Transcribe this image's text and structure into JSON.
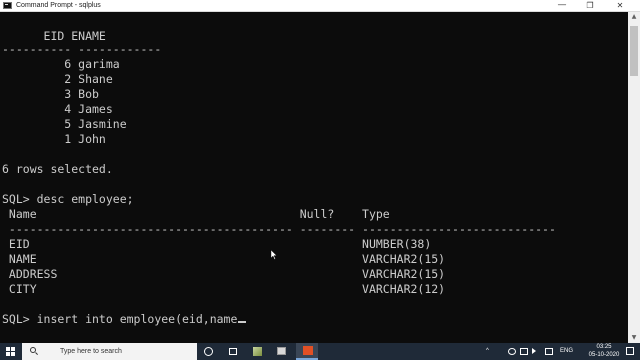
{
  "window": {
    "title": "Command Prompt - sqlplus",
    "minimize_glyph": "—",
    "maximize_glyph": "❐",
    "close_glyph": "✕"
  },
  "console": {
    "lines": [
      "      EID ENAME",
      "---------- ------------",
      "         6 garima",
      "         2 Shane",
      "         3 Bob",
      "         4 James",
      "         5 Jasmine",
      "         1 John",
      "",
      "6 rows selected.",
      "",
      "SQL> desc employee;",
      " Name                                      Null?    Type",
      " ----------------------------------------- -------- ----------------------------",
      " EID                                                NUMBER(38)",
      " NAME                                               VARCHAR2(15)",
      " ADDRESS                                            VARCHAR2(15)",
      " CITY                                               VARCHAR2(12)",
      "",
      "SQL> insert into employee(eid,name"
    ]
  },
  "taskbar": {
    "search_placeholder": "Type here to search",
    "language": "ENG",
    "time": "03:25",
    "date": "05-10-2020",
    "tray_chevron": "^"
  },
  "scrollbar": {
    "up_glyph": "▲",
    "down_glyph": "▼"
  },
  "colors": {
    "console_bg": "#0c0c0c",
    "console_text": "#cccccc",
    "taskbar_bg": "#1f2a38",
    "cmd_icon": "#e15025"
  },
  "icons": [
    "terminal-app-icon",
    "windows-start-icon",
    "search-icon",
    "cortana-icon",
    "task-view-icon",
    "file-app-icon",
    "window-app-icon",
    "command-prompt-taskbar-icon",
    "mouse-pointer-icon"
  ]
}
